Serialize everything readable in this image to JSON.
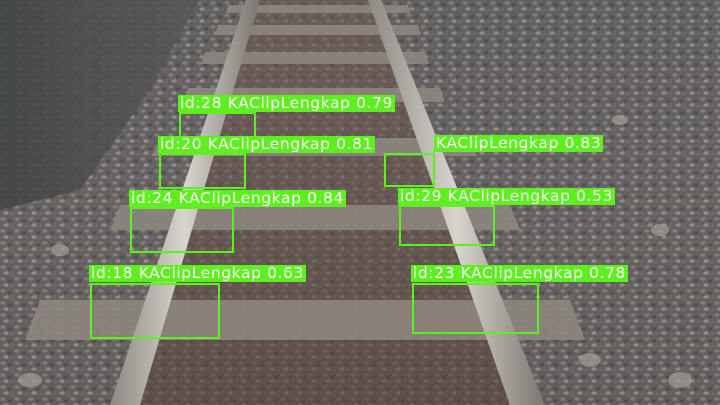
{
  "detections": [
    {
      "id_label": "id:28",
      "class_label": "KAClipLengkap",
      "confidence": "0.79"
    },
    {
      "id_label": "id:20",
      "class_label": "KAClipLengkap",
      "confidence": "0.81"
    },
    {
      "id_label": "",
      "class_label": "KAClipLengkap",
      "confidence": "0.83"
    },
    {
      "id_label": "id:24",
      "class_label": "KAClipLengkap",
      "confidence": "0.84"
    },
    {
      "id_label": "id:29",
      "class_label": "KAClipLengkap",
      "confidence": "0.53"
    },
    {
      "id_label": "id:18",
      "class_label": "KAClipLengkap",
      "confidence": "0.63"
    },
    {
      "id_label": "id:23",
      "class_label": "KAClipLengkap",
      "confidence": "0.78"
    }
  ],
  "colors": {
    "box": "#5ef01e",
    "label_text": "#ffffff",
    "ballast": "#6b6866",
    "rail": "#b9b5ae",
    "sleeper": "#8a827b"
  }
}
